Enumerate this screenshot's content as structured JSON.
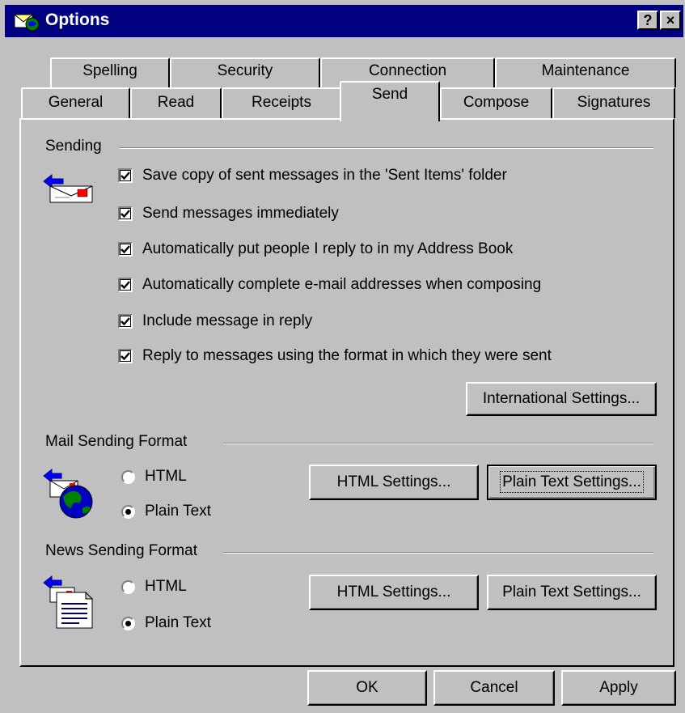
{
  "window": {
    "title": "Options",
    "help_button": "?",
    "close_button": "×"
  },
  "tabs": {
    "back_row": [
      "Spelling",
      "Security",
      "Connection",
      "Maintenance"
    ],
    "front_row": [
      "General",
      "Read",
      "Receipts",
      "Send",
      "Compose",
      "Signatures"
    ],
    "active": "Send"
  },
  "sending": {
    "label": "Sending",
    "icon": "send-mail-icon",
    "options": [
      {
        "label": "Save copy of sent messages in the 'Sent Items' folder",
        "checked": true
      },
      {
        "label": "Send messages immediately",
        "checked": true
      },
      {
        "label": "Automatically put people I reply to in my Address Book",
        "checked": true
      },
      {
        "label": "Automatically complete e-mail addresses when composing",
        "checked": true
      },
      {
        "label": "Include message in reply",
        "checked": true
      },
      {
        "label": "Reply to messages using the format in which they were sent",
        "checked": true
      }
    ],
    "international_button": "International Settings..."
  },
  "mail_format": {
    "label": "Mail Sending Format",
    "icon": "mail-globe-icon",
    "html_label": "HTML",
    "plain_label": "Plain Text",
    "selected": "Plain Text",
    "html_settings_button": "HTML Settings...",
    "plain_settings_button": "Plain Text Settings..."
  },
  "news_format": {
    "label": "News Sending Format",
    "icon": "news-document-icon",
    "html_label": "HTML",
    "plain_label": "Plain Text",
    "selected": "Plain Text",
    "html_settings_button": "HTML Settings...",
    "plain_settings_button": "Plain Text Settings..."
  },
  "footer": {
    "ok_button": "OK",
    "cancel_button": "Cancel",
    "apply_button": "Apply"
  },
  "colors": {
    "title_bar": "#000080",
    "face": "#c0c0c0"
  }
}
